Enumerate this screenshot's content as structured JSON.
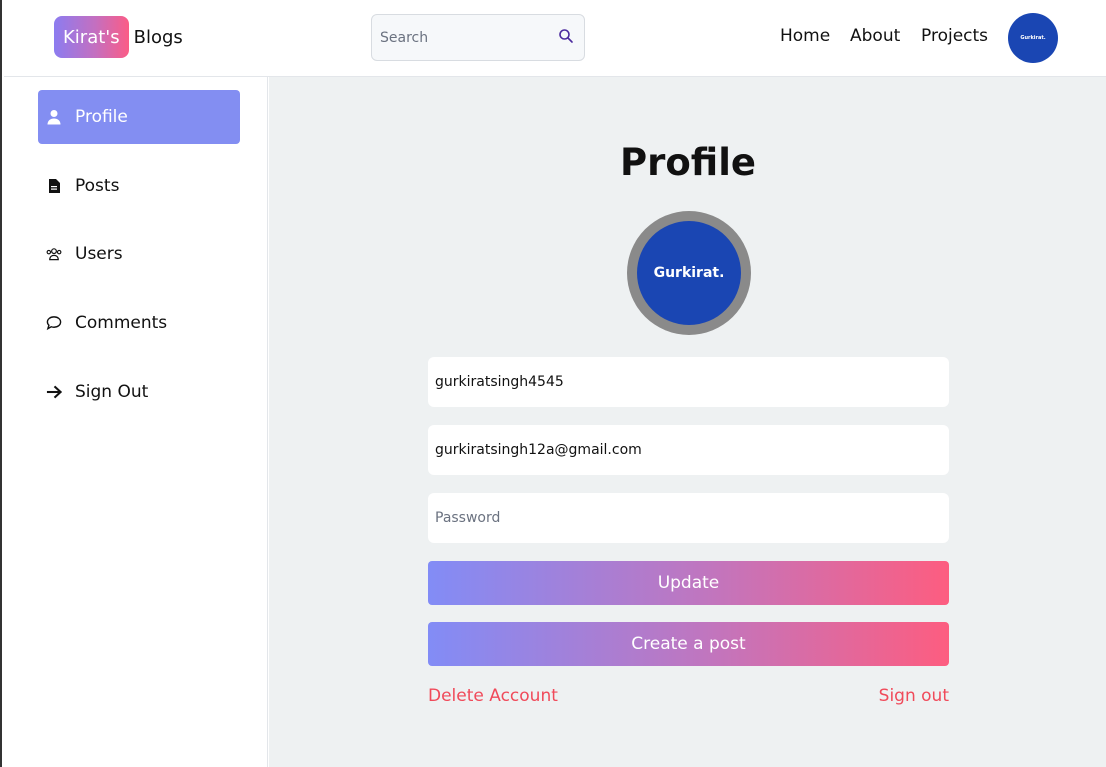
{
  "header": {
    "logo_badge": "Kirat's",
    "logo_text": "Blogs",
    "search_placeholder": "Search",
    "nav": [
      "Home",
      "About",
      "Projects"
    ],
    "avatar_label": "Gurkirat."
  },
  "sidebar": {
    "items": [
      {
        "label": "Profile",
        "icon": "user-icon",
        "active": true
      },
      {
        "label": "Posts",
        "icon": "document-icon",
        "active": false
      },
      {
        "label": "Users",
        "icon": "users-icon",
        "active": false
      },
      {
        "label": "Comments",
        "icon": "comment-icon",
        "active": false
      },
      {
        "label": "Sign Out",
        "icon": "arrow-right-icon",
        "active": false
      }
    ]
  },
  "main": {
    "title": "Profile",
    "avatar_label": "Gurkirat.",
    "username_value": "gurkiratsingh4545",
    "email_value": "gurkiratsingh12a@gmail.com",
    "password_placeholder": "Password",
    "update_label": "Update",
    "create_post_label": "Create a post",
    "delete_account_label": "Delete Account",
    "sign_out_label": "Sign out"
  },
  "colors": {
    "accent": "#838ef2",
    "gradient_start": "#828cf6",
    "gradient_end": "#fd5d80",
    "danger_link": "#f04a5a",
    "avatar_bg": "#1a46b3"
  }
}
